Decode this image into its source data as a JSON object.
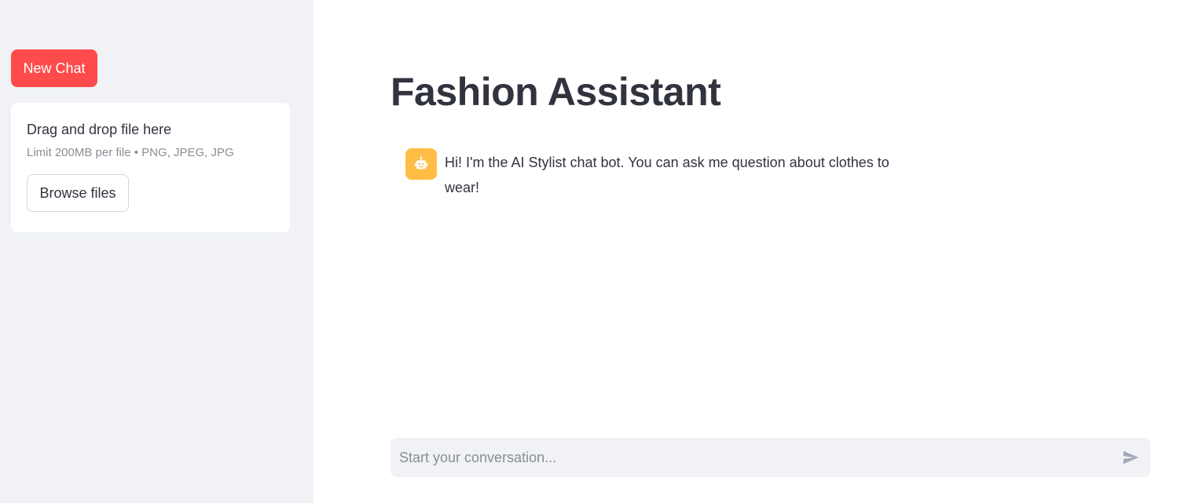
{
  "sidebar": {
    "new_chat_label": "New Chat",
    "uploader": {
      "title": "Drag and drop file here",
      "subtitle": "Limit 200MB per file • PNG, JPEG, JPG",
      "browse_label": "Browse files"
    }
  },
  "main": {
    "title": "Fashion Assistant",
    "messages": [
      {
        "role": "assistant",
        "avatar_icon": "robot-icon",
        "text": "Hi! I'm the AI Stylist chat bot. You can ask me question about clothes to wear!"
      }
    ],
    "chat_input": {
      "placeholder": "Start your conversation...",
      "value": "",
      "send_icon": "send-icon"
    }
  },
  "colors": {
    "sidebar_bg": "#f0f2f6",
    "primary": "#ff4b4b",
    "bot_avatar_bg": "#ffbd45",
    "text": "#31333f",
    "muted_text": "#8a8d97"
  }
}
